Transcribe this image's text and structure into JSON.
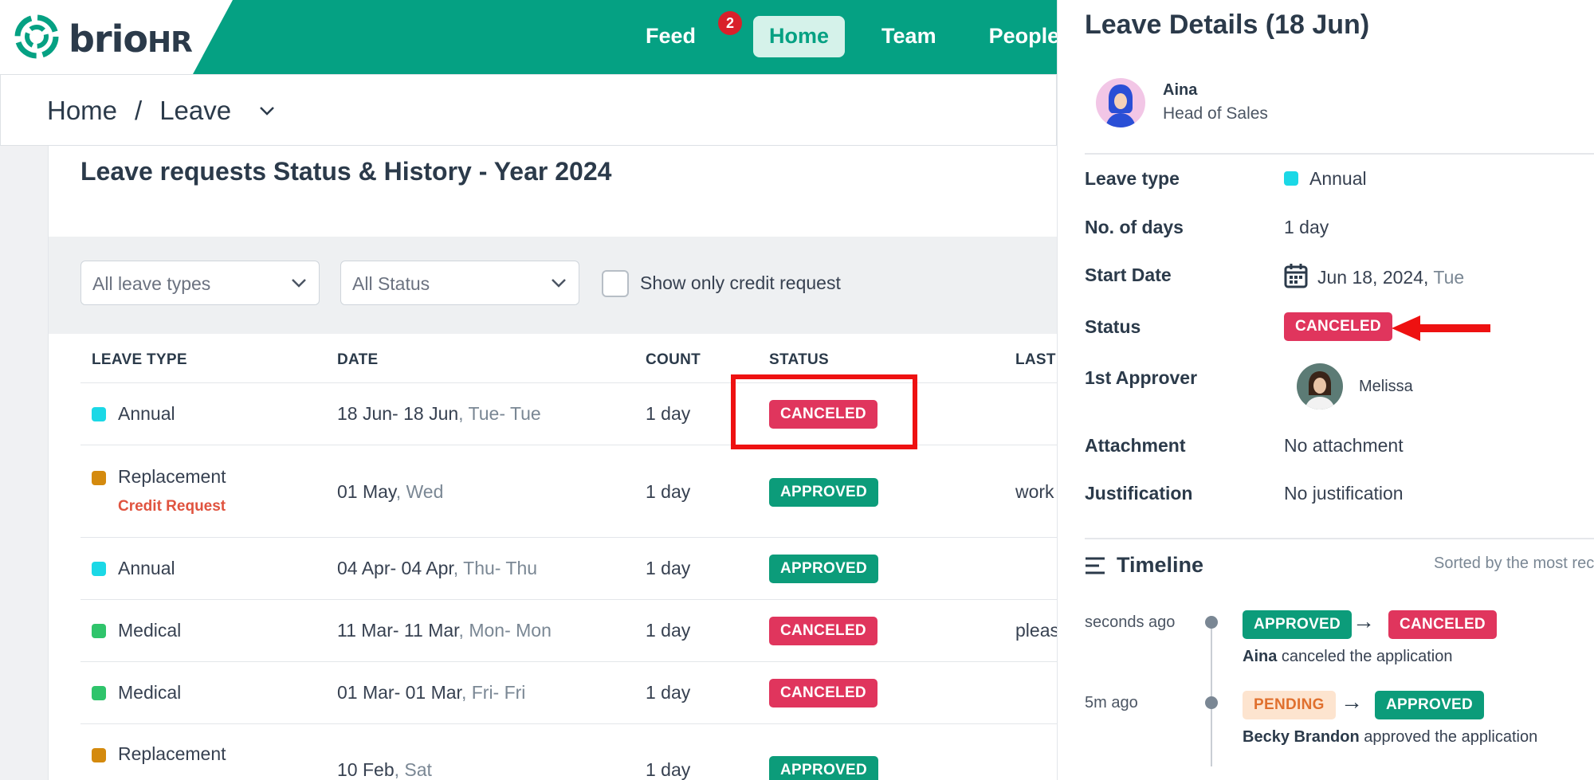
{
  "header": {
    "logo_text": "brio",
    "logo_suffix": "HR",
    "nav": [
      {
        "label": "Feed",
        "badge": "2"
      },
      {
        "label": "Home",
        "active": true
      },
      {
        "label": "Team"
      },
      {
        "label": "People"
      }
    ]
  },
  "breadcrumb": {
    "home": "Home",
    "sep": "/",
    "current": "Leave"
  },
  "main": {
    "title": "Leave requests Status & History - Year 2024",
    "filters": {
      "leave_type": "All leave types",
      "status": "All Status",
      "credit_only_label": "Show only credit request"
    },
    "columns": [
      "LEAVE TYPE",
      "DATE",
      "COUNT",
      "STATUS",
      "LAST"
    ],
    "rows": [
      {
        "type": "Annual",
        "color": "#1bd8e6",
        "date": "18 Jun- 18 Jun",
        "day": ", Tue- Tue",
        "count": "1 day",
        "status": "CANCELED",
        "last": ""
      },
      {
        "type": "Replacement",
        "color": "#d48a0e",
        "credit": "Credit Request",
        "date": "01 May",
        "day": ", Wed",
        "count": "1 day",
        "status": "APPROVED",
        "last": "work"
      },
      {
        "type": "Annual",
        "color": "#1bd8e6",
        "date": "04 Apr- 04 Apr",
        "day": ", Thu- Thu",
        "count": "1 day",
        "status": "APPROVED",
        "last": ""
      },
      {
        "type": "Medical",
        "color": "#2fc46b",
        "date": "11 Mar- 11 Mar",
        "day": ", Mon- Mon",
        "count": "1 day",
        "status": "CANCELED",
        "last": "pleas"
      },
      {
        "type": "Medical",
        "color": "#2fc46b",
        "date": "01 Mar- 01 Mar",
        "day": ", Fri- Fri",
        "count": "1 day",
        "status": "CANCELED",
        "last": ""
      },
      {
        "type": "Replacement",
        "color": "#d48a0e",
        "date": "10 Feb",
        "day": ", Sat",
        "count": "1 day",
        "status": "APPROVED",
        "last": ""
      }
    ]
  },
  "panel": {
    "title": "Leave Details (18 Jun)",
    "user": {
      "name": "Aina",
      "role": "Head of Sales"
    },
    "labels": {
      "leave_type": "Leave type",
      "days": "No. of days",
      "start": "Start Date",
      "status": "Status",
      "approver": "1st Approver",
      "attachment": "Attachment",
      "justification": "Justification"
    },
    "values": {
      "leave_type": "Annual",
      "days": "1 day",
      "start_date": "Jun 18, 2024,",
      "start_day": "Tue",
      "status": "CANCELED",
      "approver": "Melissa",
      "attachment": "No attachment",
      "justification": "No justification"
    },
    "timeline": {
      "title": "Timeline",
      "sort": "Sorted by the most recent",
      "events": [
        {
          "time": "seconds ago",
          "from": "APPROVED",
          "to": "CANCELED",
          "actor": "Aina",
          "action": " canceled the application"
        },
        {
          "time": "5m ago",
          "from": "PENDING",
          "to": "APPROVED",
          "actor": "Becky Brandon",
          "action": " approved the application"
        }
      ]
    }
  }
}
